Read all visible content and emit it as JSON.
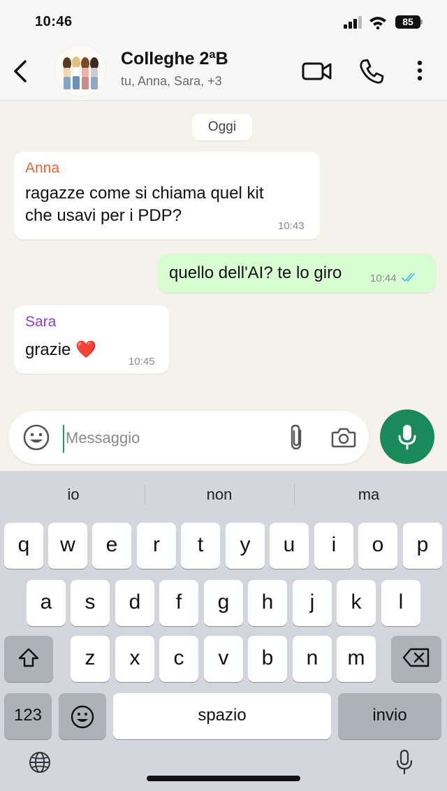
{
  "status_bar": {
    "time": "10:46",
    "battery": "85"
  },
  "header": {
    "title": "Colleghe 2ªB",
    "subtitle": "tu, Anna, Sara, +3",
    "icons": [
      "back-chevron-icon",
      "group-avatar",
      "video-call-icon",
      "phone-icon",
      "more-vertical-icon"
    ]
  },
  "chat": {
    "date_chip": "Oggi",
    "messages": [
      {
        "direction": "in",
        "sender": "Anna",
        "sender_color": "#e8663d",
        "lines": [
          "ragazze come si chiama quel kit",
          "che usavi per i PDP?"
        ],
        "time": "10:43"
      },
      {
        "direction": "out",
        "lines": [
          "quello dell'AI? te lo giro"
        ],
        "time": "10:44",
        "read": true
      },
      {
        "direction": "in",
        "sender": "Sara",
        "sender_color": "#8a3fd6",
        "lines": [
          "grazie"
        ],
        "emoji": "❤️",
        "time": "10:45"
      }
    ]
  },
  "composer": {
    "placeholder": "Messaggio",
    "value": ""
  },
  "keyboard": {
    "suggestions": [
      "io",
      "non",
      "ma"
    ],
    "row1": [
      "q",
      "w",
      "e",
      "r",
      "t",
      "y",
      "u",
      "i",
      "o",
      "p"
    ],
    "row2": [
      "a",
      "s",
      "d",
      "f",
      "g",
      "h",
      "j",
      "k",
      "l"
    ],
    "row3": [
      "z",
      "x",
      "c",
      "v",
      "b",
      "n",
      "m"
    ],
    "numbers_label": "123",
    "space_label": "spazio",
    "return_label": "invio"
  },
  "colors": {
    "accent_green": "#1b8a5a",
    "outgoing_bubble": "#d9fdd3",
    "read_ticks": "#53bdeb"
  }
}
